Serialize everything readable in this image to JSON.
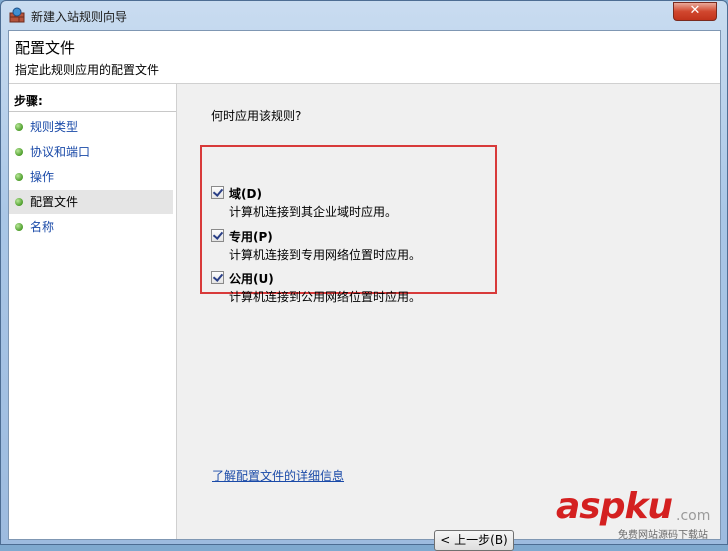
{
  "window": {
    "title": "新建入站规则向导",
    "close_symbol": "✕"
  },
  "header": {
    "title": "配置文件",
    "subtitle": "指定此规则应用的配置文件"
  },
  "sidebar": {
    "steps_title": "步骤:",
    "items": [
      {
        "label": "规则类型",
        "active": false
      },
      {
        "label": "协议和端口",
        "active": false
      },
      {
        "label": "操作",
        "active": false
      },
      {
        "label": "配置文件",
        "active": true
      },
      {
        "label": "名称",
        "active": false
      }
    ]
  },
  "main": {
    "question": "何时应用该规则?",
    "options": [
      {
        "label": "域(D)",
        "description": "计算机连接到其企业域时应用。",
        "checked": true
      },
      {
        "label": "专用(P)",
        "description": "计算机连接到专用网络位置时应用。",
        "checked": true
      },
      {
        "label": "公用(U)",
        "description": "计算机连接到公用网络位置时应用。",
        "checked": true
      }
    ],
    "learn_more_link": "了解配置文件的详细信息"
  },
  "buttons": {
    "back": "< 上一步(B)"
  },
  "watermark": {
    "brand": "aspku",
    "domain": ".com",
    "tagline": "免费网站源码下载站"
  },
  "colors": {
    "highlight_border": "#d83a3a",
    "link": "#1a4aa8",
    "brand": "#d42020"
  }
}
